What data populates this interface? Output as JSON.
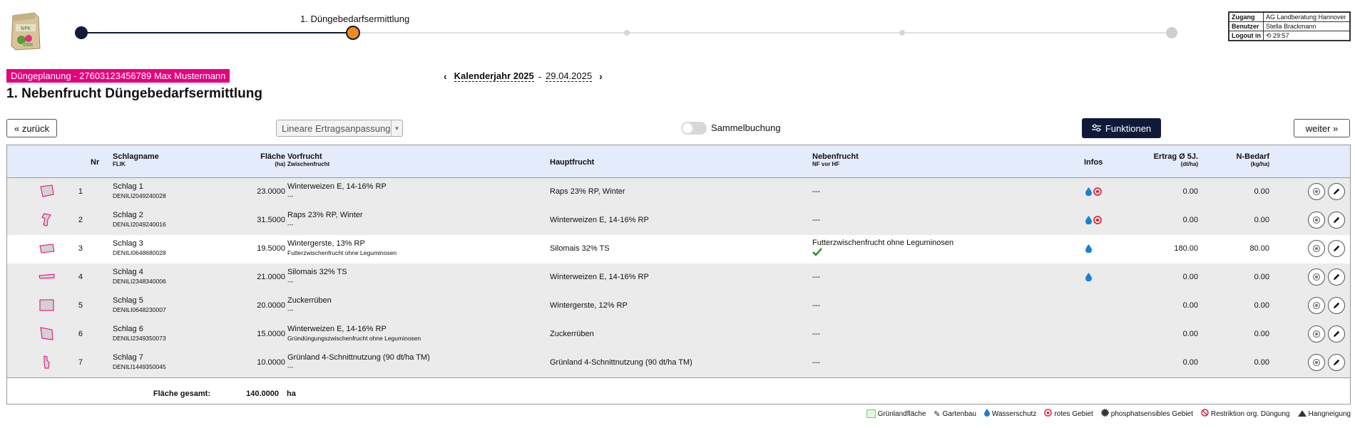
{
  "stepper": {
    "current_label": "1. Düngebedarfsermittlung"
  },
  "session": {
    "rows": [
      {
        "key": "Zugang",
        "value": "AG Landberatung Hannover"
      },
      {
        "key": "Benutzer",
        "value": "Stella Brackmann"
      },
      {
        "key": "Logout in",
        "value": "29:57"
      }
    ]
  },
  "header": {
    "badge": "Düngeplanung - 27603123456789 Max Mustermann",
    "year": "Kalenderjahr 2025",
    "separator": "-",
    "date": "29.04.2025",
    "title": "1. Nebenfrucht Düngebedarfsermittlung"
  },
  "toolbar": {
    "back_label": "«  zurück",
    "select_value": "Lineare Ertragsanpassung",
    "toggle_label": "Sammelbuchung",
    "functions_label": "Funktionen",
    "next_label": "weiter  »"
  },
  "table": {
    "headers": {
      "nr": "Nr",
      "schlagname": "Schlagname",
      "flik": "FLIK",
      "flaeche": "Fläche",
      "flaeche_unit": "(ha)",
      "vorfrucht": "Vorfrucht",
      "zwischenfrucht": "Zwischenfrucht",
      "hauptfrucht": "Hauptfrucht",
      "nebenfrucht": "Nebenfrucht",
      "nf_vor_hf": "NF vor HF",
      "infos": "Infos",
      "ertrag": "Ertrag Ø 5J.",
      "ertrag_unit": "(dt/ha)",
      "nbedarf": "N-Bedarf",
      "nbedarf_unit": "(kg/ha)"
    },
    "rows": [
      {
        "nr": "1",
        "name": "Schlag 1",
        "flik": "DENILI2049240028",
        "flaeche": "23.0000",
        "vorfrucht": "Winterweizen E, 14-16% RP",
        "zwischenfrucht": "---",
        "hauptfrucht": "Raps 23% RP, Winter",
        "nebenfrucht": "---",
        "ertrag": "0.00",
        "nbedarf": "0.00",
        "infos": [
          "water-drop-icon",
          "red-area-icon"
        ]
      },
      {
        "nr": "2",
        "name": "Schlag 2",
        "flik": "DENILI2049240016",
        "flaeche": "31.5000",
        "vorfrucht": "Raps 23% RP, Winter",
        "zwischenfrucht": "---",
        "hauptfrucht": "Winterweizen E, 14-16% RP",
        "nebenfrucht": "---",
        "ertrag": "0.00",
        "nbedarf": "0.00",
        "infos": [
          "water-drop-icon",
          "red-area-icon"
        ]
      },
      {
        "nr": "3",
        "name": "Schlag 3",
        "flik": "DENILI0648680028",
        "flaeche": "19.5000",
        "vorfrucht": "Wintergerste, 13% RP",
        "zwischenfrucht": "Futterzwischenfrucht ohne Leguminosen",
        "hauptfrucht": "Silomais 32% TS",
        "nebenfrucht": "Futterzwischenfrucht ohne Leguminosen",
        "ertrag": "180.00",
        "nbedarf": "80.00",
        "infos": [
          "water-drop-icon"
        ]
      },
      {
        "nr": "4",
        "name": "Schlag 4",
        "flik": "DENILI2348340006",
        "flaeche": "21.0000",
        "vorfrucht": "Silomais 32% TS",
        "zwischenfrucht": "---",
        "hauptfrucht": "Winterweizen E, 14-16% RP",
        "nebenfrucht": "---",
        "ertrag": "0.00",
        "nbedarf": "0.00",
        "infos": [
          "water-drop-icon"
        ]
      },
      {
        "nr": "5",
        "name": "Schlag 5",
        "flik": "DENILI0648230007",
        "flaeche": "20.0000",
        "vorfrucht": "Zuckerrüben",
        "zwischenfrucht": "---",
        "hauptfrucht": "Wintergerste, 12% RP",
        "nebenfrucht": "---",
        "ertrag": "0.00",
        "nbedarf": "0.00",
        "infos": []
      },
      {
        "nr": "6",
        "name": "Schlag 6",
        "flik": "DENILI2349350073",
        "flaeche": "15.0000",
        "vorfrucht": "Winterweizen E, 14-16% RP",
        "zwischenfrucht": "Gründüngungszwischenfrucht ohne Leguminosen",
        "hauptfrucht": "Zuckerrüben",
        "nebenfrucht": "---",
        "ertrag": "0.00",
        "nbedarf": "0.00",
        "infos": []
      },
      {
        "nr": "7",
        "name": "Schlag 7",
        "flik": "DENILI1449350045",
        "flaeche": "10.0000",
        "vorfrucht": "Grünland 4-Schnittnutzung (90 dt/ha TM)",
        "zwischenfrucht": "---",
        "hauptfrucht": "Grünland 4-Schnittnutzung (90 dt/ha TM)",
        "nebenfrucht": "---",
        "ertrag": "0.00",
        "nbedarf": "0.00",
        "infos": []
      }
    ],
    "footer": {
      "label": "Fläche gesamt:",
      "value": "140.0000",
      "unit": "ha"
    }
  },
  "legend": [
    {
      "icon": "grassland-square-icon",
      "label": "Grünlandfläche"
    },
    {
      "icon": "gardening-icon",
      "label": "Gartenbau"
    },
    {
      "icon": "water-drop-icon",
      "label": "Wasserschutz"
    },
    {
      "icon": "red-area-icon",
      "label": "rotes Gebiet"
    },
    {
      "icon": "phosphate-icon",
      "label": "phosphatsensibles Gebiet"
    },
    {
      "icon": "restriction-icon",
      "label": "Restriktion org. Düngung"
    },
    {
      "icon": "slope-icon",
      "label": "Hangneigung"
    }
  ],
  "colors": {
    "badge": "#e6007e",
    "primary_dark": "#0f1a3a",
    "step_current": "#f38a1c",
    "header_bg": "#e4ecfb",
    "water": "#1a7fd6",
    "red_area": "#e0102a",
    "check": "#1e8a1e"
  }
}
